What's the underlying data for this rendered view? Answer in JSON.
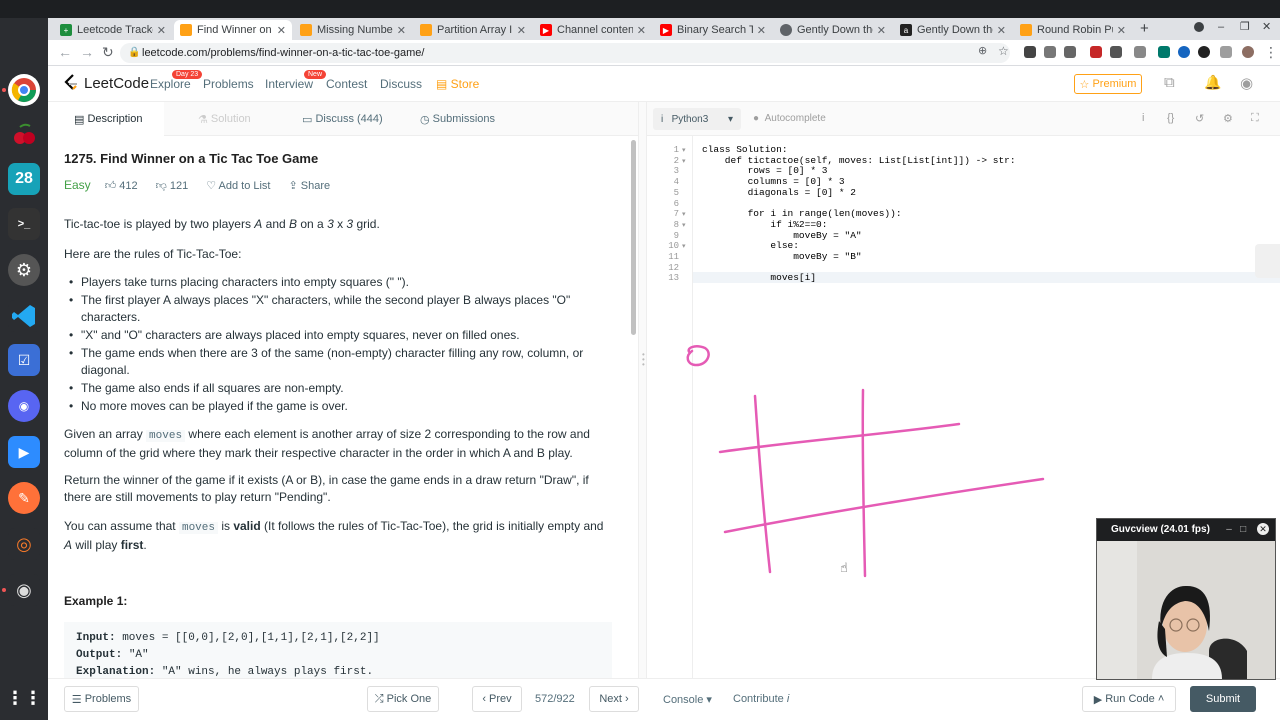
{
  "browser": {
    "tabs": [
      {
        "title": "Leetcode Tracker",
        "favicon_color": "#1e8e3e",
        "active": false
      },
      {
        "title": "Find Winner on a",
        "favicon_color": "#ffa116",
        "active": true
      },
      {
        "title": "Missing Number",
        "favicon_color": "#ffa116",
        "active": false
      },
      {
        "title": "Partition Array Into",
        "favicon_color": "#ffa116",
        "active": false
      },
      {
        "title": "Channel content",
        "favicon_color": "#ff0000",
        "active": false
      },
      {
        "title": "Binary Search Tree",
        "favicon_color": "#ff0000",
        "active": false
      },
      {
        "title": "Gently Down the",
        "favicon_color": "#5f6368",
        "active": false
      },
      {
        "title": "Gently Down the",
        "favicon_color": "#222222",
        "active": false
      },
      {
        "title": "Round Robin Pull",
        "favicon_color": "#ffa116",
        "active": false
      }
    ],
    "url": "leetcode.com/problems/find-winner-on-a-tic-tac-toe-game/"
  },
  "nav": {
    "brand": "LeetCode",
    "explore": "Explore",
    "explore_badge": "Day 23",
    "problems": "Problems",
    "interview": "Interview",
    "interview_badge": "New",
    "contest": "Contest",
    "discuss": "Discuss",
    "store": "Store",
    "premium": "Premium"
  },
  "left_tabs": {
    "description": "Description",
    "solution": "Solution",
    "discuss": "Discuss (444)",
    "submissions": "Submissions"
  },
  "problem": {
    "title": "1275. Find Winner on a Tic Tac Toe Game",
    "difficulty": "Easy",
    "likes": "412",
    "dislikes": "121",
    "add_to_list": "Add to List",
    "share": "Share",
    "intro_pre": "Tic-tac-toe is played by two players ",
    "intro_a": "A",
    "intro_and": " and ",
    "intro_b": "B",
    "intro_on": " on a ",
    "intro_size": "3",
    "intro_x": " x ",
    "intro_size2": "3",
    "intro_post": " grid.",
    "rules_heading": "Here are the rules of Tic-Tac-Toe:",
    "rules": [
      "Players take turns placing characters into empty squares (\" \").",
      "The first player A always places \"X\" characters, while the second player B always places \"O\" characters.",
      "\"X\" and \"O\" characters are always placed into empty squares, never on filled ones.",
      "The game ends when there are 3 of the same (non-empty) character filling any row, column, or diagonal.",
      "The game also ends if all squares are non-empty.",
      "No more moves can be played if the game is over."
    ],
    "given_pre": "Given an array ",
    "given_code": "moves",
    "given_post": " where each element is another array of size 2 corresponding to the row and column of the grid where they mark their respective character in the order in which A and B play.",
    "return_text": "Return the winner of the game if it exists (A or B), in case the game ends in a draw return \"Draw\", if there are still movements to play return \"Pending\".",
    "assume_pre": "You can assume that ",
    "assume_code": "moves",
    "assume_is": " is ",
    "assume_valid": "valid",
    "assume_mid": " (It follows the rules of Tic-Tac-Toe), the grid is initially empty and ",
    "assume_a": "A",
    "assume_will": " will play ",
    "assume_first": "first",
    "assume_end": ".",
    "example_title": "Example 1:",
    "example_input_label": "Input:",
    "example_input": " moves = [[0,0],[2,0],[1,1],[2,1],[2,2]]",
    "example_output_label": "Output:",
    "example_output": " \"A\"",
    "example_expl_label": "Explanation:",
    "example_expl": " \"A\" wins, he always plays first."
  },
  "editor": {
    "language": "Python3",
    "autocomplete": "Autocomplete",
    "line_numbers": [
      "1",
      "2",
      "3",
      "4",
      "5",
      "6",
      "7",
      "8",
      "9",
      "10",
      "11",
      "12",
      "13"
    ],
    "code": [
      "class Solution:",
      "    def tictactoe(self, moves: List[List[int]]) -> str:",
      "        rows = [0] * 3",
      "        columns = [0] * 3",
      "        diagonals = [0] * 2",
      "",
      "        for i in range(len(moves)):",
      "            if i%2==0:",
      "                moveBy = \"A\"",
      "            else:",
      "                moveBy = \"B\"",
      "",
      "            moves[i]"
    ]
  },
  "footer": {
    "problems": "Problems",
    "pick_one": "Pick One",
    "prev": "Prev",
    "counter": "572/922",
    "next": "Next",
    "console": "Console",
    "contribute": "Contribute",
    "run_code": "Run Code",
    "submit": "Submit"
  },
  "webcam": {
    "title": "Guvcview  (24.01 fps)"
  },
  "colors": {
    "accent": "#ffa116",
    "easy": "#43a047",
    "ink": "#e55bb5"
  }
}
